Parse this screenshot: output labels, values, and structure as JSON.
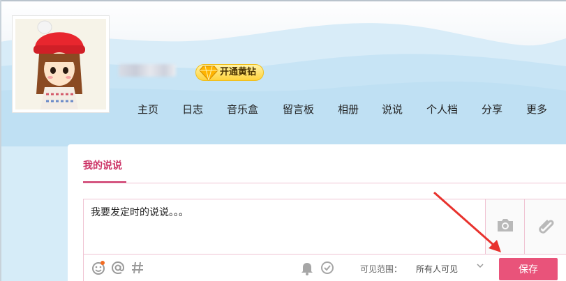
{
  "header": {
    "badge_label": "开通黄钻"
  },
  "nav": {
    "items": [
      {
        "label": "主页"
      },
      {
        "label": "日志"
      },
      {
        "label": "音乐盒"
      },
      {
        "label": "留言板"
      },
      {
        "label": "相册"
      },
      {
        "label": "说说"
      },
      {
        "label": "个人档"
      },
      {
        "label": "分享"
      },
      {
        "label": "更多"
      }
    ]
  },
  "panel": {
    "tab_title": "我的说说",
    "editor_text": "我要发定时的说说。。。",
    "scope_label": "可见范围：",
    "scope_value": "所有人可见",
    "save_label": "保存"
  },
  "icons": {
    "side": [
      "camera-icon",
      "attachment-icon"
    ],
    "toolbar": [
      "emoji-icon",
      "mention-icon",
      "topic-hash-icon",
      "bell-icon",
      "timer-check-icon",
      "chevron-down-icon"
    ]
  },
  "colors": {
    "accent": "#cc3366",
    "save_button": "#e9537a",
    "annotation_arrow": "#e8322d",
    "vip_gold": "#ffd23a"
  }
}
